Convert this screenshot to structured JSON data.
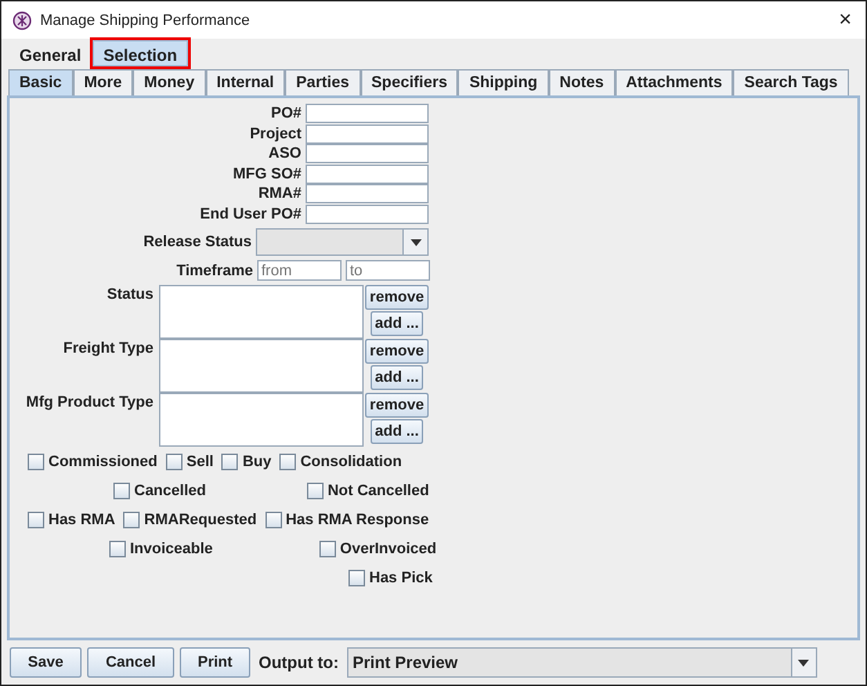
{
  "window": {
    "title": "Manage Shipping Performance",
    "close": "×"
  },
  "outer_tabs": [
    {
      "label": "General",
      "selected": false,
      "highlighted": false
    },
    {
      "label": "Selection",
      "selected": true,
      "highlighted": true
    }
  ],
  "inner_tabs": [
    {
      "label": "Basic",
      "selected": true
    },
    {
      "label": "More",
      "selected": false
    },
    {
      "label": "Money",
      "selected": false
    },
    {
      "label": "Internal",
      "selected": false
    },
    {
      "label": "Parties",
      "selected": false
    },
    {
      "label": "Specifiers",
      "selected": false
    },
    {
      "label": "Shipping",
      "selected": false
    },
    {
      "label": "Notes",
      "selected": false
    },
    {
      "label": "Attachments",
      "selected": false
    },
    {
      "label": "Search Tags",
      "selected": false
    }
  ],
  "text_fields": [
    {
      "label": "PO#"
    },
    {
      "label": "Project"
    },
    {
      "label": "ASO"
    },
    {
      "label": "MFG SO#"
    },
    {
      "label": "RMA#"
    },
    {
      "label": "End User PO#"
    }
  ],
  "release_status": {
    "label": "Release Status"
  },
  "timeframe": {
    "label": "Timeframe",
    "from_placeholder": "from",
    "to_placeholder": "to"
  },
  "lists": [
    {
      "label": "Status",
      "remove": "remove",
      "add": "add ..."
    },
    {
      "label": "Freight Type",
      "remove": "remove",
      "add": "add ..."
    },
    {
      "label": "Mfg Product Type",
      "remove": "remove",
      "add": "add ..."
    }
  ],
  "checkbox_rows": [
    [
      {
        "label": "Commissioned",
        "checked": false
      },
      {
        "label": "Sell",
        "checked": false
      },
      {
        "label": "Buy",
        "checked": false
      },
      {
        "label": "Consolidation",
        "checked": false
      }
    ],
    [
      {
        "label": "Cancelled",
        "checked": false
      },
      {
        "label": "Not Cancelled",
        "checked": false
      }
    ],
    [
      {
        "label": "Has RMA",
        "checked": false
      },
      {
        "label": "RMARequested",
        "checked": false
      },
      {
        "label": "Has RMA Response",
        "checked": false
      }
    ],
    [
      {
        "label": "Invoiceable",
        "checked": false
      },
      {
        "label": "OverInvoiced",
        "checked": false
      }
    ],
    [
      {
        "label": "Has Pick",
        "checked": false
      }
    ]
  ],
  "buttons": [
    "Save",
    "Cancel",
    "Print"
  ],
  "output": {
    "label": "Output to:",
    "value": "Print Preview"
  }
}
